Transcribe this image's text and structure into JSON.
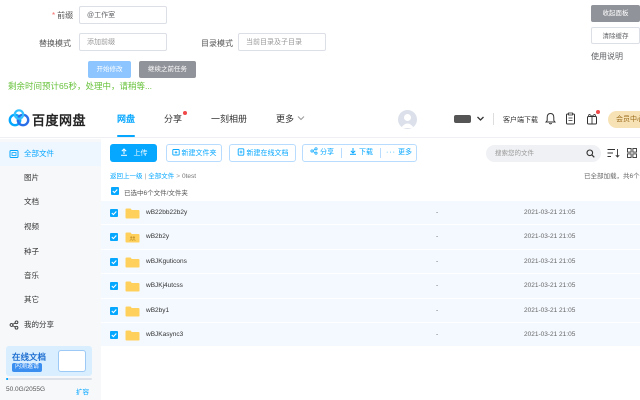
{
  "tool": {
    "prefix_label": "前缀",
    "prefix_value": "@工作室",
    "replace_label": "替换模式",
    "replace_placeholder": "添加前缀",
    "dir_label": "目录模式",
    "dir_placeholder": "当前目录及子目录",
    "start_button": "开始修改",
    "continue_button": "继续之前任务",
    "collapse_panel": "收起面板",
    "clear_cache": "清除缓存",
    "help": "使用说明",
    "status": "剩余时间预计65秒，处理中，请稍等..."
  },
  "header": {
    "logo_text": "百度网盘",
    "nav": [
      "网盘",
      "分享",
      "一刻相册",
      "更多"
    ],
    "client_download": "客户端下载",
    "member": "会员中心"
  },
  "sidebar": {
    "items": [
      {
        "label": "全部文件",
        "icon": "folder-icon"
      },
      {
        "label": "图片"
      },
      {
        "label": "文档"
      },
      {
        "label": "视频"
      },
      {
        "label": "种子"
      },
      {
        "label": "音乐"
      },
      {
        "label": "其它"
      },
      {
        "label": "我的分享",
        "icon": "share-icon"
      }
    ],
    "promo_title": "在线文档",
    "promo_tag": "内测邀请",
    "storage_text": "50.0G/2055G",
    "storage_fraction": 0.024,
    "expand": "扩容"
  },
  "toolbar": {
    "upload": "上传",
    "new_folder": "新建文件夹",
    "new_doc": "新建在线文档",
    "share": "分享",
    "download": "下载",
    "more": "更多",
    "search_placeholder": "搜索您的文件"
  },
  "breadcrumb": {
    "back": "返回上一级",
    "all": "全部文件",
    "current": "0test"
  },
  "list": {
    "loaded_text": "已全部加载，共6个",
    "selected_text": "已选中6个文件/文件夹",
    "rows": [
      {
        "name": "wB22bb22b2y",
        "size": "-",
        "date": "2021-03-21 21:05"
      },
      {
        "name": "wB2b2y",
        "size": "-",
        "date": "2021-03-21 21:05"
      },
      {
        "name": "wBJKguticons",
        "size": "-",
        "date": "2021-03-21 21:05"
      },
      {
        "name": "wBJKj4utcss",
        "size": "-",
        "date": "2021-03-21 21:05"
      },
      {
        "name": "wB2by1",
        "size": "-",
        "date": "2021-03-21 21:05"
      },
      {
        "name": "wBJKasync3",
        "size": "-",
        "date": "2021-03-21 21:05"
      }
    ]
  },
  "colors": {
    "accent": "#06a7ff",
    "status_green": "#67c23a",
    "row_bg": "#f4f9ff",
    "folder_yellow": "#ffd15c"
  }
}
